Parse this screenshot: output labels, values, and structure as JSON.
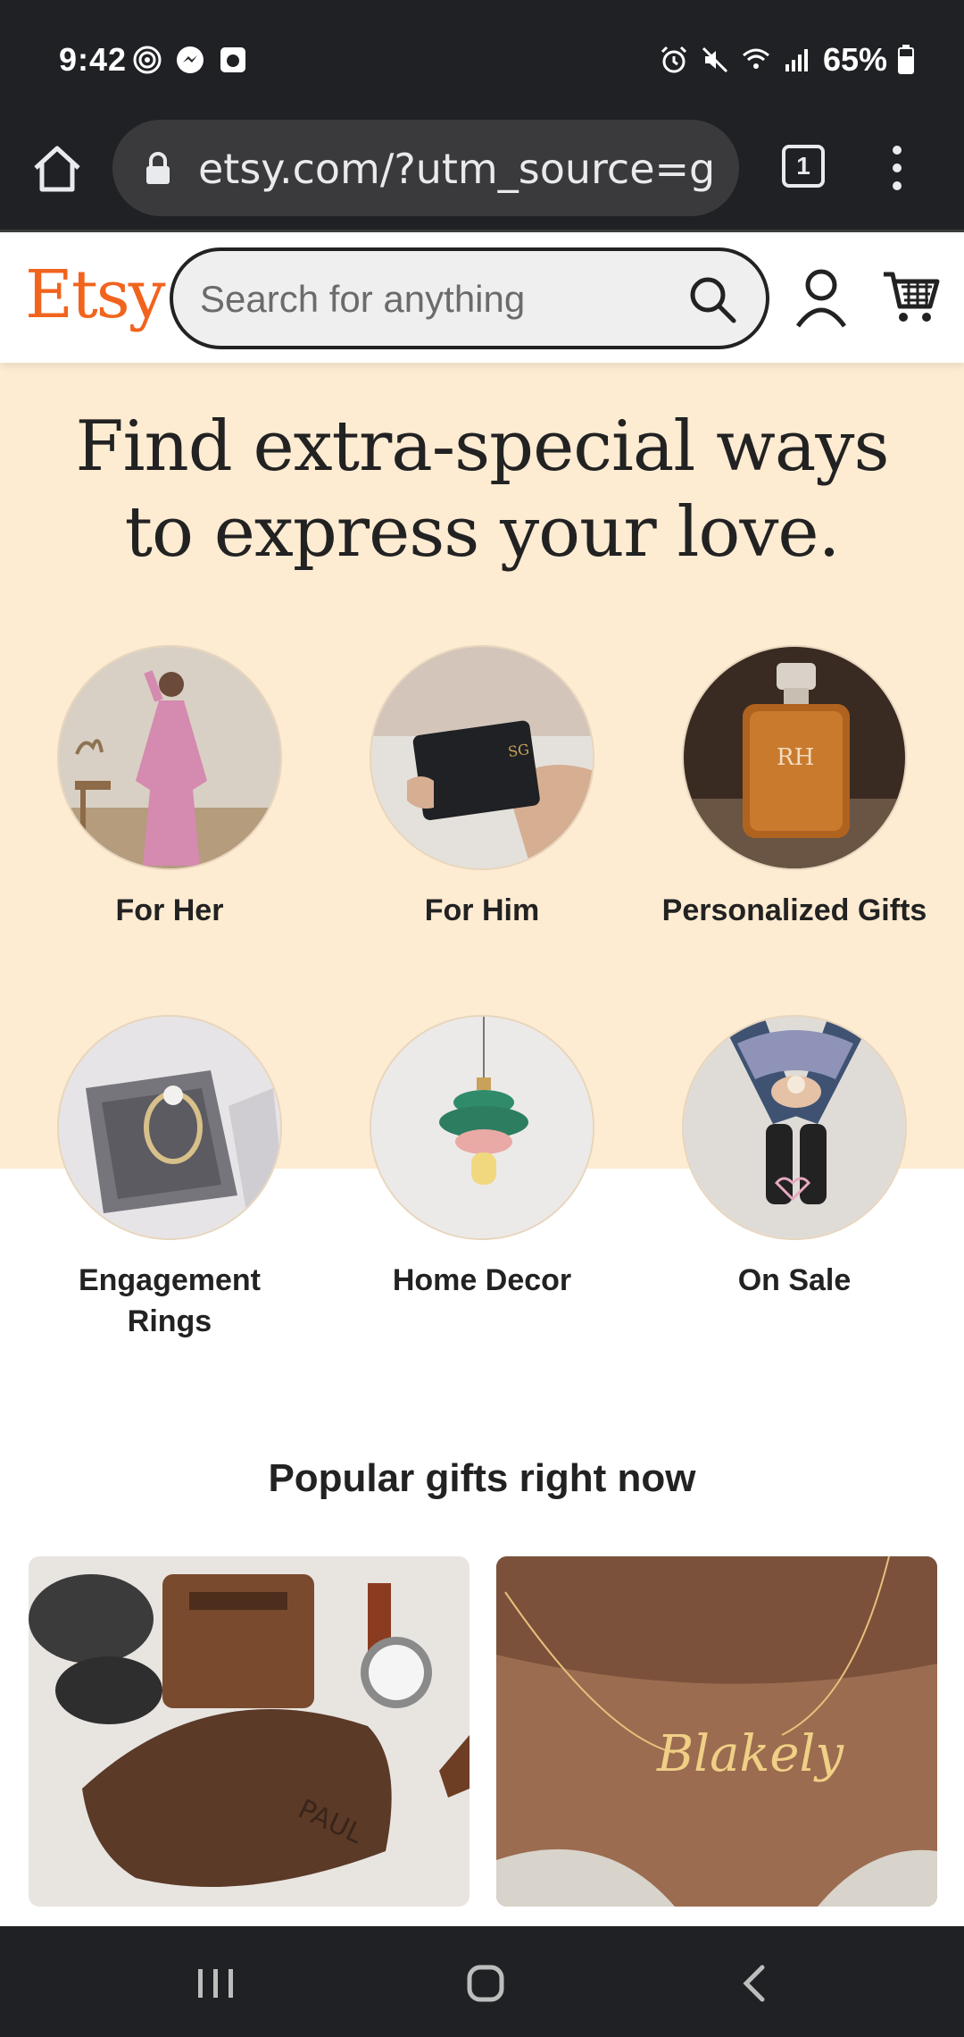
{
  "status": {
    "time": "9:42",
    "battery": "65%"
  },
  "browser": {
    "url": "etsy.com/?utm_source=g",
    "tab_count": "1"
  },
  "header": {
    "logo": "Etsy",
    "search_placeholder": "Search for anything"
  },
  "hero": {
    "title": "Find extra-special ways to express your love."
  },
  "categories": [
    {
      "label": "For Her"
    },
    {
      "label": "For Him"
    },
    {
      "label": "Personalized Gifts"
    },
    {
      "label": "Engagement Rings"
    },
    {
      "label": "Home Decor"
    },
    {
      "label": "On Sale"
    }
  ],
  "popular": {
    "title": "Popular gifts right now"
  },
  "colors": {
    "brand": "#F1641E",
    "hero_bg": "#FDEBD2",
    "chrome_bg": "#202124"
  }
}
